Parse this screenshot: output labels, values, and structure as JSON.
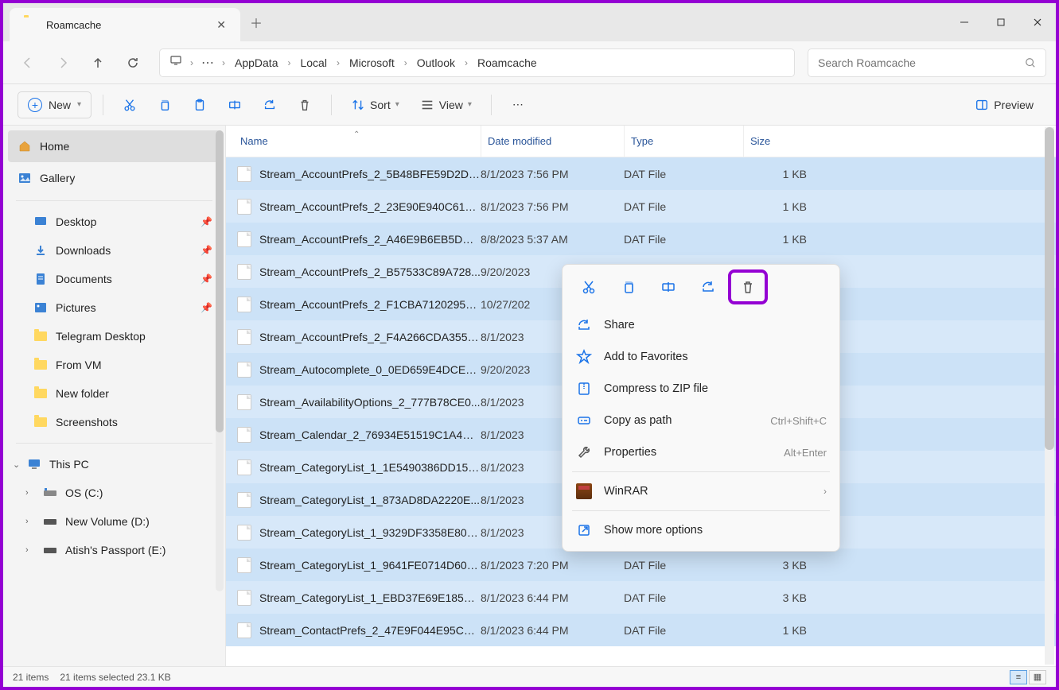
{
  "window": {
    "title": "Roamcache"
  },
  "breadcrumb": [
    "AppData",
    "Local",
    "Microsoft",
    "Outlook",
    "Roamcache"
  ],
  "search": {
    "placeholder": "Search Roamcache"
  },
  "toolbar": {
    "new_label": "New",
    "sort_label": "Sort",
    "view_label": "View",
    "preview_label": "Preview"
  },
  "columns": {
    "name": "Name",
    "date": "Date modified",
    "type": "Type",
    "size": "Size"
  },
  "sidebar": {
    "home": "Home",
    "gallery": "Gallery",
    "pinned": [
      "Desktop",
      "Downloads",
      "Documents",
      "Pictures"
    ],
    "recent": [
      "Telegram Desktop",
      "From VM",
      "New folder",
      "Screenshots"
    ],
    "thispc_label": "This PC",
    "drives": [
      "OS (C:)",
      "New Volume (D:)",
      "Atish's Passport  (E:)"
    ]
  },
  "files": [
    {
      "name": "Stream_AccountPrefs_2_5B48BFE59D2DD...",
      "date": "8/1/2023 7:56 PM",
      "type": "DAT File",
      "size": "1 KB"
    },
    {
      "name": "Stream_AccountPrefs_2_23E90E940C61A...",
      "date": "8/1/2023 7:56 PM",
      "type": "DAT File",
      "size": "1 KB"
    },
    {
      "name": "Stream_AccountPrefs_2_A46E9B6EB5DB2...",
      "date": "8/8/2023 5:37 AM",
      "type": "DAT File",
      "size": "1 KB"
    },
    {
      "name": "Stream_AccountPrefs_2_B57533C89A728...",
      "date": "9/20/2023",
      "type": "",
      "size": ""
    },
    {
      "name": "Stream_AccountPrefs_2_F1CBA71202957...",
      "date": "10/27/202",
      "type": "",
      "size": ""
    },
    {
      "name": "Stream_AccountPrefs_2_F4A266CDA355E...",
      "date": "8/1/2023",
      "type": "",
      "size": ""
    },
    {
      "name": "Stream_Autocomplete_0_0ED659E4DCE5...",
      "date": "9/20/2023",
      "type": "",
      "size": ""
    },
    {
      "name": "Stream_AvailabilityOptions_2_777B78CE0...",
      "date": "8/1/2023",
      "type": "",
      "size": ""
    },
    {
      "name": "Stream_Calendar_2_76934E51519C1A4EA...",
      "date": "8/1/2023",
      "type": "",
      "size": ""
    },
    {
      "name": "Stream_CategoryList_1_1E5490386DD152...",
      "date": "8/1/2023",
      "type": "",
      "size": ""
    },
    {
      "name": "Stream_CategoryList_1_873AD8DA2220E...",
      "date": "8/1/2023",
      "type": "",
      "size": ""
    },
    {
      "name": "Stream_CategoryList_1_9329DF3358E801...",
      "date": "8/1/2023",
      "type": "",
      "size": ""
    },
    {
      "name": "Stream_CategoryList_1_9641FE0714D609...",
      "date": "8/1/2023 7:20 PM",
      "type": "DAT File",
      "size": "3 KB"
    },
    {
      "name": "Stream_CategoryList_1_EBD37E69E185B6...",
      "date": "8/1/2023 6:44 PM",
      "type": "DAT File",
      "size": "3 KB"
    },
    {
      "name": "Stream_ContactPrefs_2_47E9F044E95CA0...",
      "date": "8/1/2023 6:44 PM",
      "type": "DAT File",
      "size": "1 KB"
    }
  ],
  "context_menu": {
    "share": "Share",
    "favorites": "Add to Favorites",
    "compress": "Compress to ZIP file",
    "copypath": "Copy as path",
    "copypath_sc": "Ctrl+Shift+C",
    "properties": "Properties",
    "properties_sc": "Alt+Enter",
    "winrar": "WinRAR",
    "more": "Show more options"
  },
  "status": {
    "count": "21 items",
    "selected": "21 items selected  23.1 KB"
  }
}
